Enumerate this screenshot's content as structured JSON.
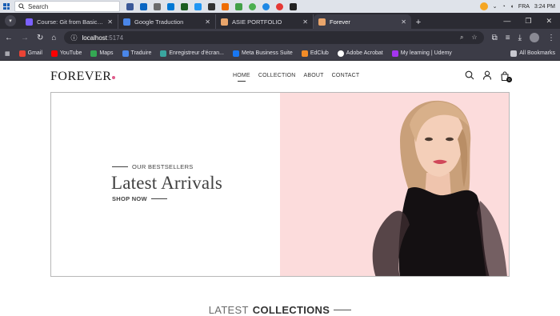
{
  "taskbar": {
    "search_label": "Search",
    "language": "FRA",
    "time": "3:24 PM"
  },
  "browser": {
    "tabs": [
      {
        "title": "Course: Git from Basics to Advanced",
        "favicon_color": "#7b61ff",
        "active": false
      },
      {
        "title": "Google Traduction",
        "favicon_color": "#4a86e8",
        "active": false
      },
      {
        "title": "ASIE PORTFOLIO",
        "favicon_color": "#e9a56b",
        "active": false
      },
      {
        "title": "Forever",
        "favicon_color": "#e9a56b",
        "active": true
      }
    ],
    "address": {
      "host": "localhost",
      "port": ":5174"
    },
    "bookmarks": [
      {
        "label": "Gmail",
        "color": "#ea4335"
      },
      {
        "label": "YouTube",
        "color": "#ff0000"
      },
      {
        "label": "Maps",
        "color": "#34a853"
      },
      {
        "label": "Traduire",
        "color": "#4a86e8"
      },
      {
        "label": "Enregistreur d'écran...",
        "color": "#3aa6a0"
      },
      {
        "label": "Meta Business Suite",
        "color": "#1877f2"
      },
      {
        "label": "EdClub",
        "color": "#f28c28"
      },
      {
        "label": "Adobe Acrobat",
        "color": "#ffffff"
      },
      {
        "label": "My learning | Udemy",
        "color": "#a435f0"
      }
    ],
    "all_bookmarks": "All Bookmarks"
  },
  "site": {
    "logo": "FOREVER",
    "nav": [
      {
        "label": "HOME",
        "active": true
      },
      {
        "label": "COLLECTION",
        "active": false
      },
      {
        "label": "ABOUT",
        "active": false
      },
      {
        "label": "CONTACT",
        "active": false
      }
    ],
    "cart_count": "0",
    "hero": {
      "eyebrow": "OUR BESTSELLERS",
      "headline": "Latest Arrivals",
      "cta": "SHOP NOW",
      "bg_color": "#fcdcdc"
    },
    "section_title_light": "LATEST",
    "section_title_bold": "COLLECTIONS"
  }
}
